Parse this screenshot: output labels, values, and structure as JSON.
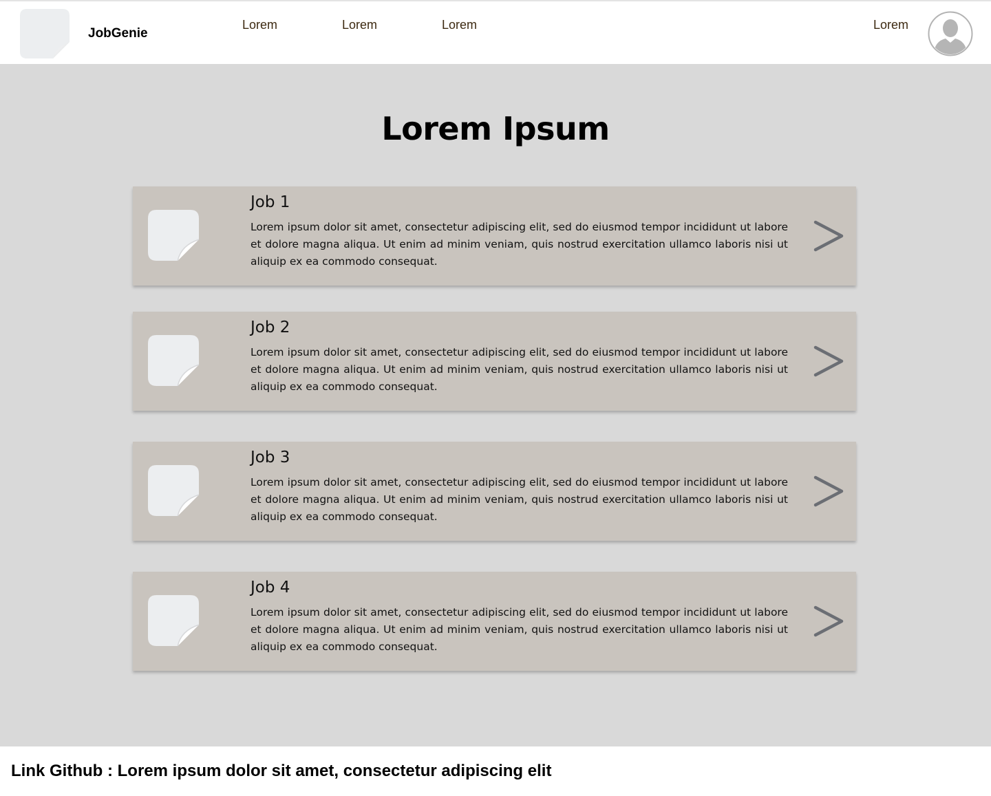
{
  "header": {
    "brand": "JobGenie",
    "nav": [
      "Lorem",
      "Lorem",
      "Lorem"
    ],
    "right_link": "Lorem",
    "logo_icon": "image-placeholder-icon",
    "avatar_icon": "user-avatar-icon"
  },
  "main": {
    "title": "Lorem Ipsum",
    "jobs": [
      {
        "title": "Job 1",
        "description": "Lorem ipsum dolor sit amet, consectetur adipiscing elit, sed do eiusmod tempor incididunt ut labore et dolore magna aliqua. Ut enim ad minim veniam, quis nostrud exercitation ullamco laboris nisi ut aliquip ex ea commodo consequat.",
        "icon": "image-placeholder-icon",
        "action_icon": "chevron-right-icon"
      },
      {
        "title": "Job 2",
        "description": "Lorem ipsum dolor sit amet, consectetur adipiscing elit, sed do eiusmod tempor incididunt ut labore et dolore magna aliqua. Ut enim ad minim veniam, quis nostrud exercitation ullamco laboris nisi ut aliquip ex ea commodo consequat.",
        "icon": "image-placeholder-icon",
        "action_icon": "chevron-right-icon"
      },
      {
        "title": "Job 3",
        "description": "Lorem ipsum dolor sit amet, consectetur adipiscing elit, sed do eiusmod tempor incididunt ut labore et dolore magna aliqua. Ut enim ad minim veniam, quis nostrud exercitation ullamco laboris nisi ut aliquip ex ea commodo consequat.",
        "icon": "image-placeholder-icon",
        "action_icon": "chevron-right-icon"
      },
      {
        "title": "Job 4",
        "description": "Lorem ipsum dolor sit amet, consectetur adipiscing elit, sed do eiusmod tempor incididunt ut labore et dolore magna aliqua. Ut enim ad minim veniam, quis nostrud exercitation ullamco laboris nisi ut aliquip ex ea commodo consequat.",
        "icon": "image-placeholder-icon",
        "action_icon": "chevron-right-icon"
      }
    ]
  },
  "footer": {
    "text": "Link Github : Lorem ipsum dolor sit amet, consectetur adipiscing elit"
  },
  "colors": {
    "page_background": "#d9d9d9",
    "header_background": "#ffffff",
    "card_background": "#c9c4be",
    "nav_text": "#3d2a12",
    "chevron": "#6b6e74",
    "placeholder": "#eceef0"
  }
}
